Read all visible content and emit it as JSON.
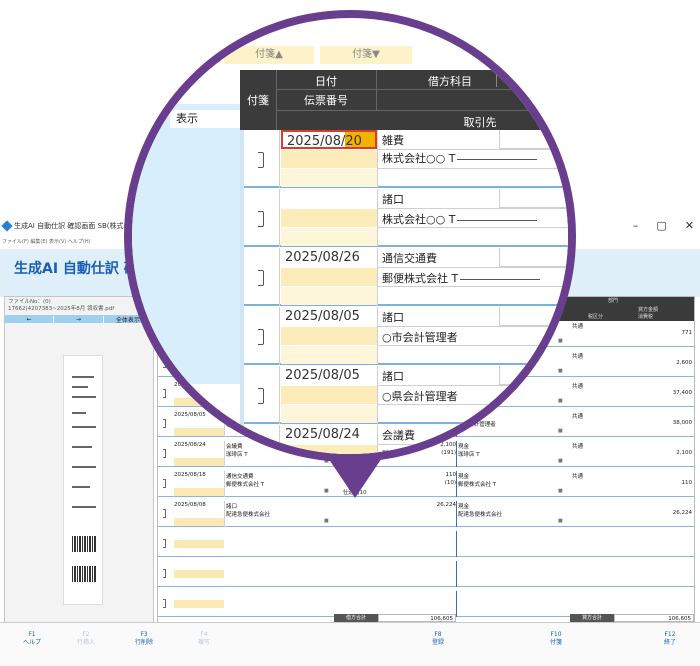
{
  "app": {
    "window_title": "生成AI 自動仕訳 確認画面 SB(株式会社…",
    "menu": "ファイル(F)  編集(E)  表示(V)  ヘルプ(H)",
    "window_controls": [
      "–",
      "▢",
      "✕"
    ],
    "banner_title": "生成AI 自動仕訳 確",
    "file_label": "ファイルNo：(0)",
    "file_name": "17662(4207383~2025年8月  領収書.pdf",
    "nav": {
      "prev": "←",
      "next": "→",
      "show_all": "全体表示"
    },
    "grid_header_caption": "部門",
    "grid_header_caption2": "貸方金額",
    "grid_header_caption3": "税区分",
    "grid_header_caption4": "消費税",
    "grid_rows": [
      {
        "date": "",
        "debit_account": "",
        "debit_partner": "",
        "amount": "",
        "credit_account": "",
        "credit_partner": "",
        "tax": "共通",
        "credit_amount": "771"
      },
      {
        "date": "",
        "debit_account": "",
        "debit_partner": "",
        "amount": "",
        "credit_account": "",
        "credit_partner": "",
        "tax": "共通",
        "credit_amount": "2,600"
      },
      {
        "date": "2025/08/05",
        "debit_account": "",
        "debit_partner": "",
        "amount": "",
        "credit_account": "",
        "credit_partner": "○会計管理者",
        "tax": "共通",
        "credit_amount": "37,400"
      },
      {
        "date": "2025/08/05",
        "debit_account": "諸口",
        "debit_partner": "○市会計管理者",
        "amount": "38,000",
        "credit_account": "現金",
        "credit_partner": "○市会計管理者",
        "tax": "共通",
        "credit_amount": "38,000"
      },
      {
        "date": "2025/08/24",
        "debit_account": "会議費",
        "debit_partner": "珈琲店 T",
        "amount": "2,100",
        "amount2": "(191)",
        "credit_account": "現金",
        "credit_partner": "珈琲店 T",
        "tax": "共通",
        "credit_amount": "2,100"
      },
      {
        "date": "2025/08/18",
        "debit_account": "通信交通費",
        "debit_partner": "郵便株式会社 T",
        "amount": "110",
        "amount2": "(10)",
        "credit_account": "現金",
        "credit_partner": "郵便株式会社 T",
        "tax": "共通",
        "credit_amount": "110",
        "note": "仕通内10"
      },
      {
        "date": "2025/08/08",
        "debit_account": "諸口",
        "debit_partner": "配達急便株式会社",
        "amount": "26,224",
        "credit_account": "現金",
        "credit_partner": "配達急便株式会社",
        "tax": "",
        "credit_amount": "26,224"
      }
    ],
    "totals": {
      "debit_label": "借方合計",
      "debit_total": "106,605",
      "credit_label": "貸方合計",
      "credit_total": "106,605"
    },
    "fkeys": [
      {
        "key": "F1",
        "label": "ヘルプ",
        "enabled": true
      },
      {
        "key": "F2",
        "label": "行挿入",
        "enabled": false
      },
      {
        "key": "F3",
        "label": "行削除",
        "enabled": true
      },
      {
        "key": "F4",
        "label": "複写",
        "enabled": false
      },
      {
        "key": "F8",
        "label": "登録",
        "enabled": true
      },
      {
        "key": "F10",
        "label": "付箋",
        "enabled": true
      },
      {
        "key": "F12",
        "label": "終了",
        "enabled": true
      }
    ]
  },
  "magnifier": {
    "side_label": "表示",
    "toolbar": {
      "tag_up": "付箋▲",
      "tag_down": "付箋▼"
    },
    "header": {
      "tag": "付箋",
      "date": "日付",
      "voucher_no": "伝票番号",
      "debit_account": "借方科目",
      "partner": "取引先"
    },
    "rows": [
      {
        "date": "2025/08/20",
        "account": "雑費",
        "vendor": "株式会社○○ T",
        "selected": true
      },
      {
        "date": "",
        "account": "諸口",
        "vendor": "株式会社○○ T",
        "selected": false
      },
      {
        "date": "2025/08/26",
        "account": "通信交通費",
        "vendor": "郵便株式会社 T",
        "selected": false
      },
      {
        "date": "2025/08/05",
        "account": "諸口",
        "vendor": "○市会計管理者",
        "selected": false
      },
      {
        "date": "2025/08/05",
        "account": "諸口",
        "vendor": "○県会計管理者",
        "selected": false
      },
      {
        "date": "2025/08/24",
        "account": "会議費",
        "vendor": "珈琲店 T",
        "selected": false
      }
    ]
  },
  "colors": {
    "accent": "#1a5fb0",
    "magnifier_ring": "#6a3e8f",
    "highlight_yellow": "#fcecb9",
    "selection_red": "#e03a2a"
  }
}
